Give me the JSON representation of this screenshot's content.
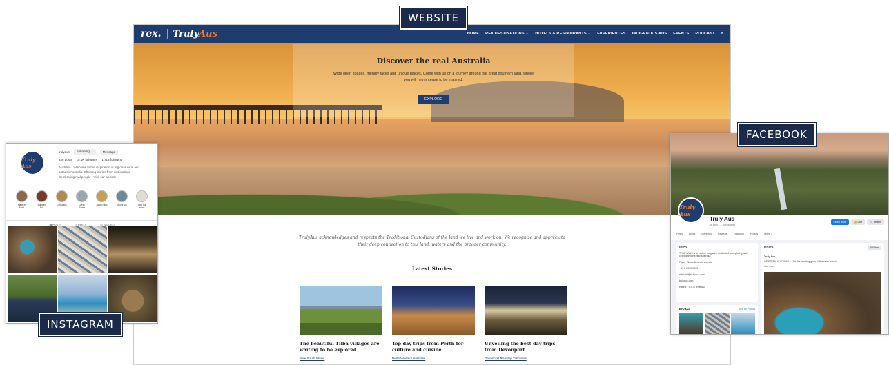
{
  "labels": {
    "website": "WEBSITE",
    "instagram": "INSTAGRAM",
    "facebook": "FACEBOOK"
  },
  "website": {
    "logo_rex": "rex.",
    "logo_truly": "Truly",
    "logo_aus": "Aus",
    "menu": [
      "HOME",
      "REX DESTINATIONS ⌄",
      "HOTELS & RESTAURANTS ⌄",
      "EXPERIENCES",
      "INDIGENOUS AUS",
      "EVENTS",
      "PODCAST",
      "⌕"
    ],
    "hero_title": "Discover the real Australia",
    "hero_text": "Wide open spaces, friendly faces and unique places. Come with us on a journey around our great southern land, where you will never cease to be inspired.",
    "hero_button": "EXPLORE",
    "acknowledgement": "TrulyAus acknowledges and respects the Traditional Custodians of the land we live and work on. We recognise and appreciate their deep connection to this land, waters and the broader community.",
    "latest_heading": "Latest Stories",
    "stories": [
      {
        "title": "The beautiful Tilba villages are waiting to be explored",
        "tag": "New South Wales"
      },
      {
        "title": "Top day trips from Perth for culture and cuisine",
        "tag": "Perth  Western Australia"
      },
      {
        "title": "Unveiling the best day trips from Devonport",
        "tag": "Devonport  Roadtrip  Tasmania"
      }
    ]
  },
  "instagram": {
    "avatar_text": "Truly Aus",
    "handle": "trulyaus",
    "following_btn": "Following ⌄",
    "message_btn": "Message",
    "posts": "326 posts",
    "followers": "15.1K followers",
    "following": "1,718 following",
    "bio": "Australia · Welcome to the inspiration of regional, rural and outback Australia. Showing stories from destinations · Celebrating real people · Visit our website",
    "highlights": [
      "Made in Mont",
      "Bundled Ad..",
      "Getaways",
      "Great Burnie",
      "Stop Tropic",
      "Mount Mo",
      "Find out more"
    ],
    "tabs": [
      "▦ POSTS",
      "▷ REELS",
      "◫ TAGGED"
    ]
  },
  "facebook": {
    "avatar_text": "Truly Aus",
    "name": "Truly Aus",
    "sub": "6k likes · 7.1k followers",
    "actions": [
      "Learn more",
      "👍 Like",
      "🔍 Search"
    ],
    "tabs": [
      "Posts",
      "About",
      "Mentions",
      "Reviews",
      "Followers",
      "Photos",
      "More ⌄"
    ],
    "intro_title": "Intro",
    "intro_text": "TRULY AUS is an online magazine dedicated to exploring and celebrating the real Australia",
    "intro_items": [
      "Page · News & media website",
      "+61 2 8000 0000",
      "editorial@trulyaus.com",
      "trulyaus.com",
      "Rating · 4.9 (8 reviews)"
    ],
    "photos_title": "Photos",
    "photos_link": "See All Photos",
    "posts_title": "Posts",
    "posts_filter": "⚙ Filters",
    "post_author": "Truly Aus",
    "post_text": "WESTERN AUSTRALIA · It's the morning glow, Wilderness Island",
    "post_link": "See more"
  }
}
